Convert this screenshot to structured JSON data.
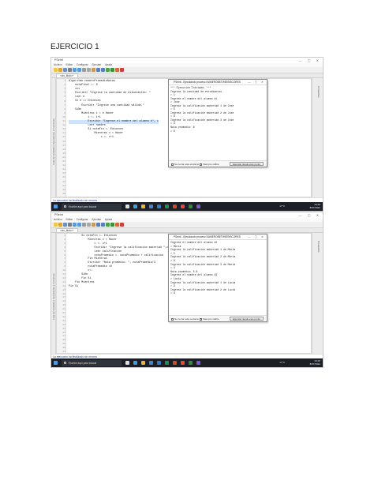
{
  "document": {
    "title": "EJERCICIO 1"
  },
  "app": {
    "title": "PSeInt",
    "menu": [
      "Archivo",
      "Editar",
      "Configurar",
      "Ejecutar",
      "Ayuda"
    ],
    "tab_label": "<sin_titulo>*",
    "left_panel_label": "Lista de Variables | Operadores y Funciones",
    "right_panel_label": "Comandos",
    "status_message": "La ejecución ha finalizado sin errores"
  },
  "console": {
    "title": "PSeInt - Ejecutando proceso NUMEROBETWEENSCORES",
    "footer_checkbox_1": "No cerrar esta ventana",
    "footer_checkbox_2": "Siempre visible",
    "run_button": "Ejecutar desde este punto"
  },
  "screenshot1": {
    "code_lines": [
      "Algoritmo numeroPromedioNotas",
      "",
      "    notaFinal <- 0",
      "",
      "    cnt",
      "",
      "    Escribir \"Ingrese la cantidad de estudiantes: \"",
      "",
      "    Leer e",
      "",
      "    Si e <= Entonces",
      "",
      "        Escribir \"Ingrese una cantidad válida.\"",
      "",
      "    SiNo",
      "",
      "        Mientras i < e Hacer",
      "",
      "            i <- i+1",
      "",
      "            Escribir \"Ingrese el nombre del alumno #\", i",
      "",
      "            Leer nombre",
      "",
      "            Si notaFin <- Entonces",
      "",
      "                Mientras c < Hacer",
      "",
      "                    c <- c+1"
    ],
    "console_lines": [
      "*** Ejecución Iniciada. ***",
      "Ingrese la cantidad de estudiantes",
      "> 1",
      "Ingrese el nombre del alumno #1",
      "> Jose",
      "Ingrese la calificación materia# 1 de Jose",
      "> 5",
      "Ingrese la calificación materia# 2 de Jose",
      "> 6",
      "Ingrese la calificación materia# 3 de Jose",
      "> 9",
      "Nota promedio: 6",
      "> 6"
    ]
  },
  "screenshot2": {
    "code_lines": [
      "        Si notaFin <- Entonces",
      "",
      "            Mientras c < Hacer",
      "",
      "                c <- c+1",
      "",
      "                Escribir \"Ingrese la calificación materia# \",c,\" de\"",
      "",
      "                Leer calificacion",
      "",
      "                notaPromedio <- notaPromedio + calificacion",
      "",
      "",
      "",
      "",
      "",
      "            Fin Mientras",
      "",
      "            Escribir \"Nota promedio: \", notaPromedio/3",
      "",
      "            notaPromedio <0",
      "",
      "            c<-",
      "",
      "        SiNo",
      "",
      "        Fin Si",
      "",
      "    Fin Mientras",
      "",
      "Fin Si"
    ],
    "console_lines": [
      "Ingrese el nombre del alumno #2",
      "> Maria",
      "Ingrese la calificación materia# 1 de Maria",
      "> 5",
      "Ingrese la calificación materia# 2 de Maria",
      "> 8",
      "Ingrese la calificación materia# 3 de Maria",
      "> 4",
      "Nota promedio: 5.6",
      "Ingrese el nombre del alumno #3",
      "> Lucia",
      "Ingrese la calificación materia# 1 de Lucia",
      "> 9",
      "Ingrese la calificación materia# 2 de Lucia",
      "> 9"
    ]
  },
  "taskbar": {
    "search_placeholder": "Escribe aquí para buscar",
    "weather": "17°C",
    "time": "23:48",
    "date": "8/07/2022"
  },
  "colors": {
    "taskbar_bg": "#1c1f26",
    "status_text": "#1b3aa6",
    "keyword": "#1a1a8c",
    "string": "#1f7a1f"
  }
}
